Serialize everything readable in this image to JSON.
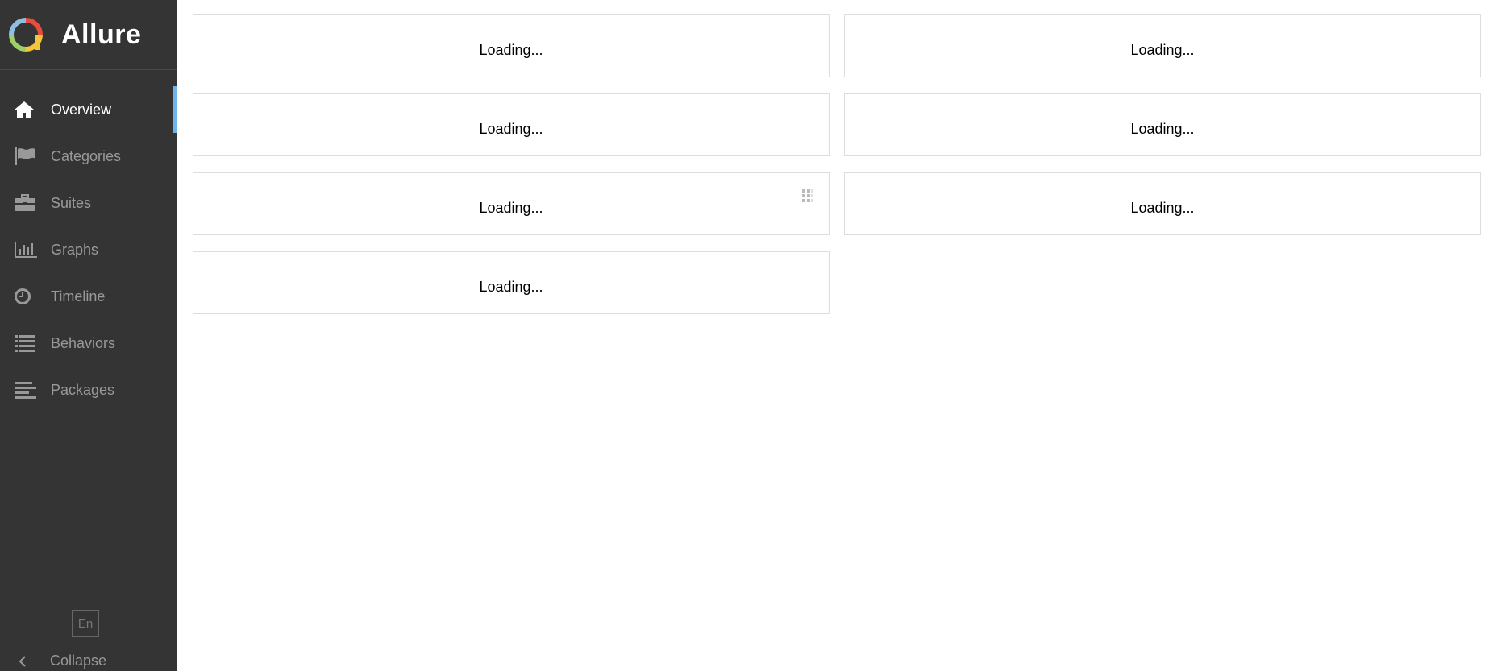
{
  "brand": {
    "name": "Allure"
  },
  "sidebar": {
    "items": [
      {
        "label": "Overview",
        "icon": "home-icon",
        "active": true
      },
      {
        "label": "Categories",
        "icon": "flag-icon"
      },
      {
        "label": "Suites",
        "icon": "briefcase-icon"
      },
      {
        "label": "Graphs",
        "icon": "bar-chart-icon"
      },
      {
        "label": "Timeline",
        "icon": "clock-icon"
      },
      {
        "label": "Behaviors",
        "icon": "list-icon"
      },
      {
        "label": "Packages",
        "icon": "align-left-icon"
      }
    ],
    "language": "En",
    "collapse_label": "Collapse"
  },
  "widgets": [
    {
      "text": "Loading..."
    },
    {
      "text": "Loading..."
    },
    {
      "text": "Loading..."
    },
    {
      "text": "Loading..."
    },
    {
      "text": "Loading..."
    },
    {
      "text": "Loading..."
    },
    {
      "text": "Loading..."
    }
  ],
  "colors": {
    "sidebar_bg": "#343434",
    "active_indicator": "#6eb4e8",
    "nav_text": "#999999",
    "nav_text_active": "#ffffff"
  }
}
